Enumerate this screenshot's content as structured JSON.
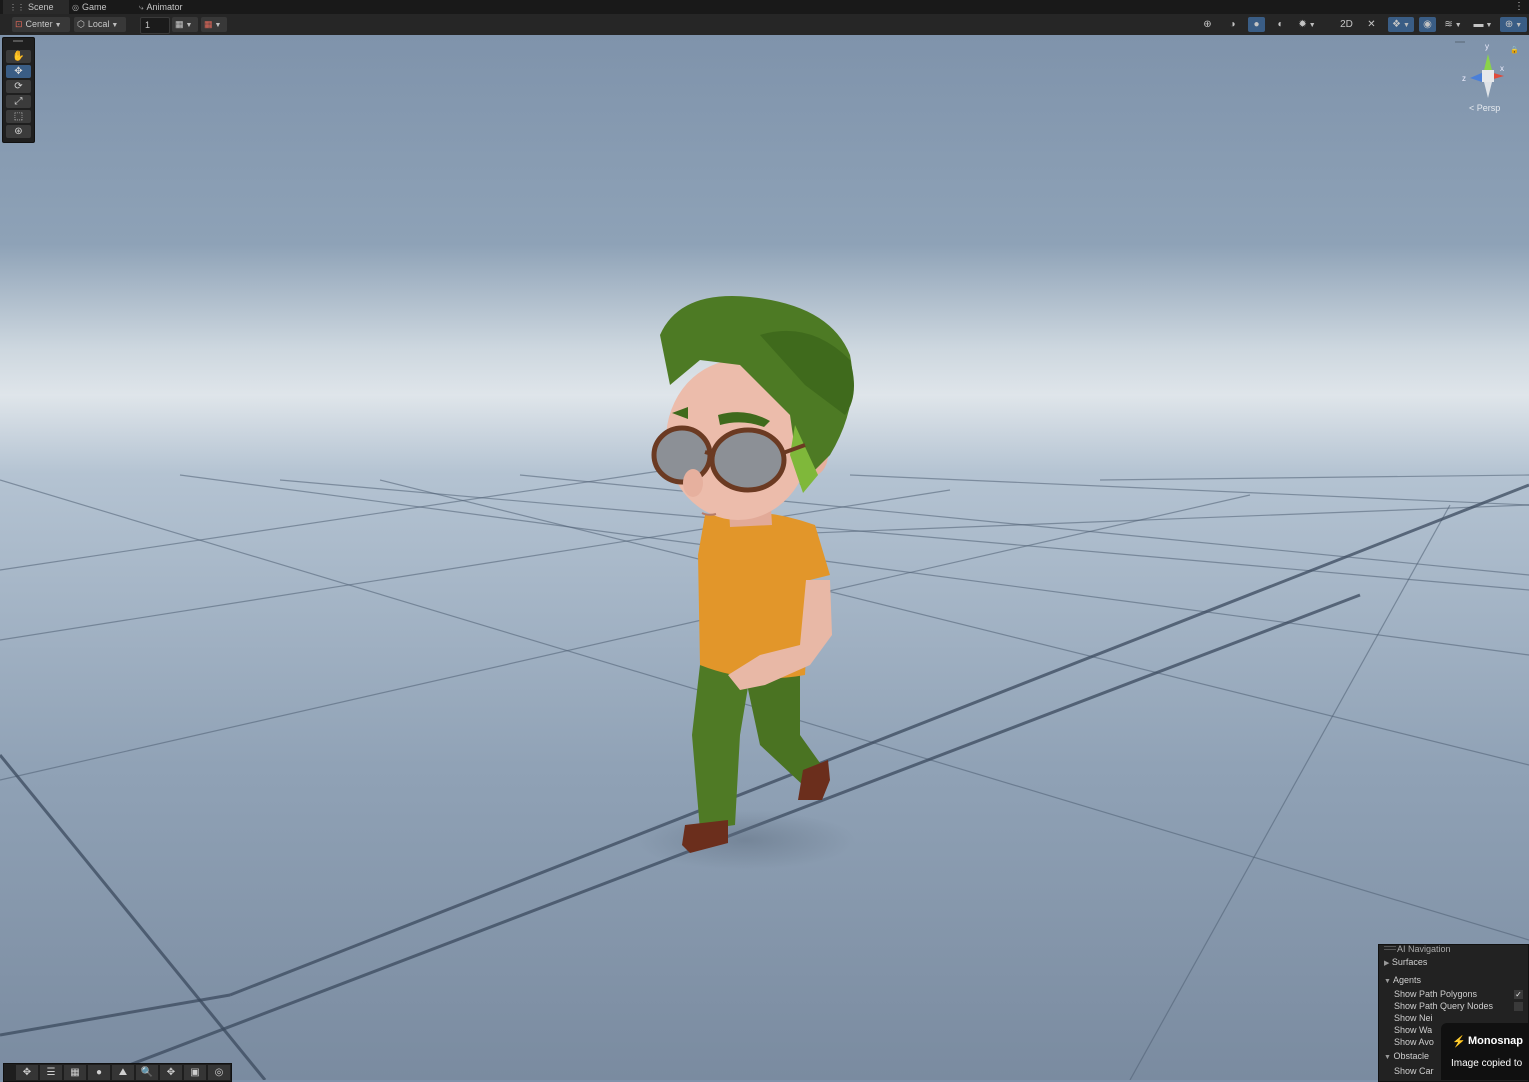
{
  "tabs": [
    {
      "label": "Scene",
      "icon": "grid-icon"
    },
    {
      "label": "Game",
      "icon": "gamepad-icon"
    },
    {
      "label": "Animator",
      "icon": "animator-icon"
    }
  ],
  "toolbar": {
    "pivot_mode": "Center",
    "pivot_rotation": "Local",
    "grid_snap_value": "1"
  },
  "gizmo": {
    "y_label": "y",
    "x_label": "x",
    "z_label": "z",
    "projection": "< Persp"
  },
  "ai_navigation": {
    "title": "AI Navigation",
    "surfaces": "Surfaces",
    "agents": "Agents",
    "show_path_polygons": "Show Path Polygons",
    "show_path_query_nodes": "Show Path Query Nodes",
    "row3": "Show Nei",
    "row4": "Show Wa",
    "row5": "Show Avo",
    "obstacles": "Obstacle",
    "row7": "Show Car",
    "check_mark": "✓"
  },
  "monosnap": {
    "title": "Monosnap",
    "message": "Image copied to"
  },
  "colors": {
    "accent_selected": "#3a5d85",
    "toolbar_bg": "#262626",
    "sky_top": "#7f93ab",
    "horizon": "#d8e0e6",
    "ground": "#8fa1b5",
    "hair": "#4d7a24",
    "shirt": "#e2962a",
    "pants": "#4f7a25",
    "shoes": "#6b2e1c",
    "skin": "#e8b8a6"
  }
}
